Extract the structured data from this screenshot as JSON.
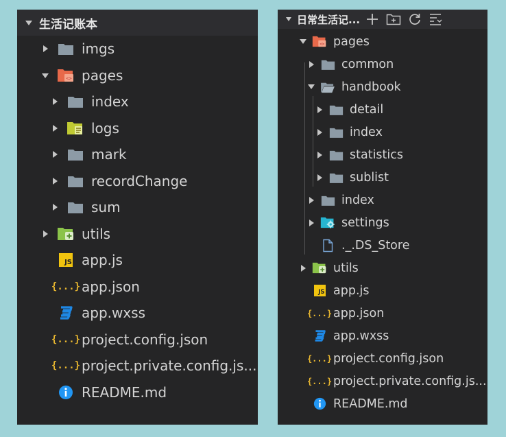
{
  "left": {
    "title": "生活记账本",
    "items": [
      {
        "label": "imgs"
      },
      {
        "label": "pages"
      },
      {
        "label": "index"
      },
      {
        "label": "logs"
      },
      {
        "label": "mark"
      },
      {
        "label": "recordChange"
      },
      {
        "label": "sum"
      },
      {
        "label": "utils"
      },
      {
        "label": "app.js"
      },
      {
        "label": "app.json"
      },
      {
        "label": "app.wxss"
      },
      {
        "label": "project.config.json"
      },
      {
        "label": "project.private.config.js..."
      },
      {
        "label": "README.md"
      }
    ]
  },
  "right": {
    "title": "日常生活记...",
    "items": [
      {
        "label": "pages"
      },
      {
        "label": "common"
      },
      {
        "label": "handbook"
      },
      {
        "label": "detail"
      },
      {
        "label": "index"
      },
      {
        "label": "statistics"
      },
      {
        "label": "sublist"
      },
      {
        "label": "index"
      },
      {
        "label": "settings"
      },
      {
        "label": "._.DS_Store"
      },
      {
        "label": "utils"
      },
      {
        "label": "app.js"
      },
      {
        "label": "app.json"
      },
      {
        "label": "app.wxss"
      },
      {
        "label": "project.config.json"
      },
      {
        "label": "project.private.config.js..."
      },
      {
        "label": "README.md"
      }
    ]
  },
  "icons": {
    "js": "JS",
    "json": "{...}"
  },
  "colors": {
    "background": "#9fd3d8",
    "panel": "#252526",
    "folder": "#8d9ba6",
    "pages_folder": "#e8694a",
    "utils_folder": "#8bc34a",
    "logs_folder": "#c0ca33",
    "settings_folder": "#26b5d1",
    "js_badge": "#f1c40f",
    "json_braces": "#e8b730",
    "css_icon": "#1e88e5",
    "info_icon": "#2196f3"
  }
}
